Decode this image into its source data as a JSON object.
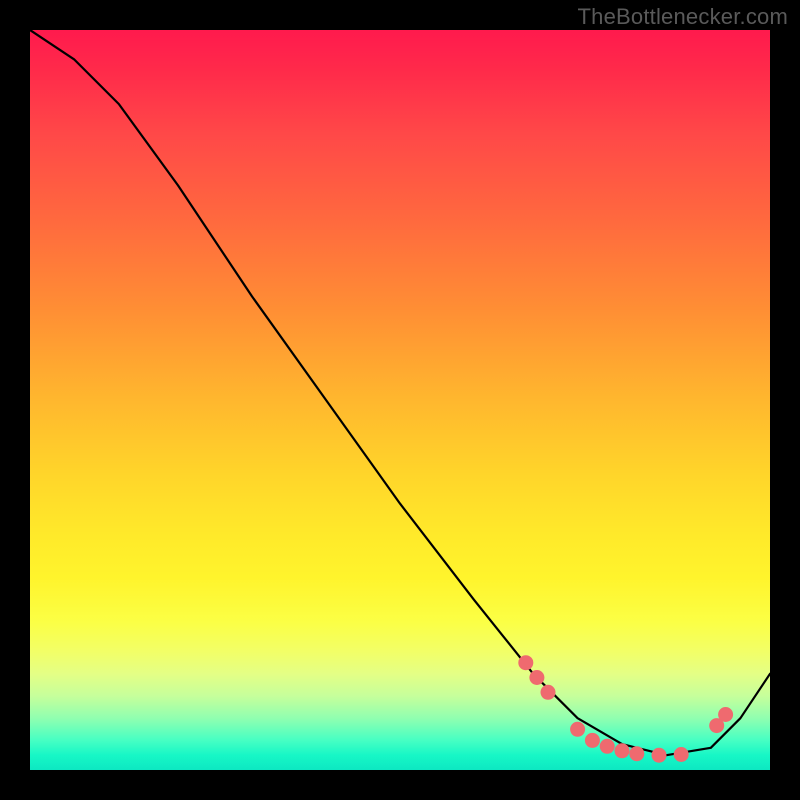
{
  "watermark": "TheBottlenecker.com",
  "chart_data": {
    "type": "line",
    "title": "",
    "xlabel": "",
    "ylabel": "",
    "xlim": [
      0,
      1
    ],
    "ylim": [
      0,
      1
    ],
    "series": [
      {
        "name": "curve",
        "x": [
          0.0,
          0.06,
          0.12,
          0.2,
          0.3,
          0.4,
          0.5,
          0.6,
          0.68,
          0.74,
          0.8,
          0.86,
          0.92,
          0.96,
          1.0
        ],
        "y": [
          1.0,
          0.96,
          0.9,
          0.79,
          0.64,
          0.5,
          0.36,
          0.23,
          0.13,
          0.07,
          0.035,
          0.02,
          0.03,
          0.07,
          0.13
        ]
      }
    ],
    "highlight_points": {
      "name": "dots",
      "color": "#ef6a6f",
      "x": [
        0.67,
        0.685,
        0.7,
        0.74,
        0.76,
        0.78,
        0.8,
        0.82,
        0.85,
        0.88,
        0.928,
        0.94
      ],
      "y": [
        0.145,
        0.125,
        0.105,
        0.055,
        0.04,
        0.032,
        0.026,
        0.022,
        0.02,
        0.021,
        0.06,
        0.075
      ]
    },
    "gradient_stops": [
      {
        "pos": 0.0,
        "color": "#ff1a4d"
      },
      {
        "pos": 0.5,
        "color": "#ffd52a"
      },
      {
        "pos": 0.8,
        "color": "#fbff45"
      },
      {
        "pos": 1.0,
        "color": "#0de8c2"
      }
    ]
  }
}
